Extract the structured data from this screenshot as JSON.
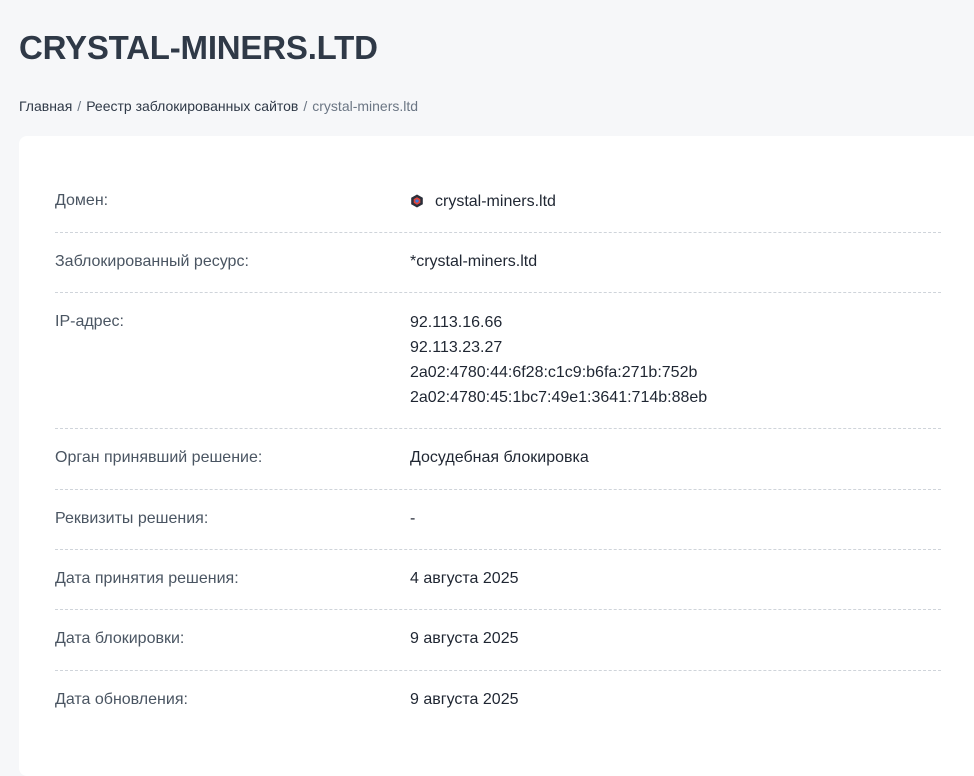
{
  "title": "CRYSTAL-MINERS.LTD",
  "breadcrumb": {
    "home": "Главная",
    "registry": "Реестр заблокированных сайтов",
    "current": "crystal-miners.ltd",
    "separator": "/"
  },
  "details": {
    "domain": {
      "label": "Домен:",
      "value": "crystal-miners.ltd",
      "icon": "site-favicon-icon"
    },
    "blocked_resource": {
      "label": "Заблокированный ресурс:",
      "value": "*crystal-miners.ltd"
    },
    "ip": {
      "label": "IP-адрес:",
      "values": [
        "92.113.16.66",
        "92.113.23.27",
        "2a02:4780:44:6f28:c1c9:b6fa:271b:752b",
        "2a02:4780:45:1bc7:49e1:3641:714b:88eb"
      ]
    },
    "authority": {
      "label": "Орган принявший решение:",
      "value": "Досудебная блокировка"
    },
    "decision_details": {
      "label": "Реквизиты решения:",
      "value": "-"
    },
    "decision_date": {
      "label": "Дата принятия решения:",
      "value": "4 августа 2025"
    },
    "block_date": {
      "label": "Дата блокировки:",
      "value": "9 августа 2025"
    },
    "update_date": {
      "label": "Дата обновления:",
      "value": "9 августа 2025"
    }
  },
  "colors": {
    "background": "#f6f7f9",
    "card": "#ffffff",
    "title": "#2f3947",
    "divider": "#cfd4da"
  }
}
